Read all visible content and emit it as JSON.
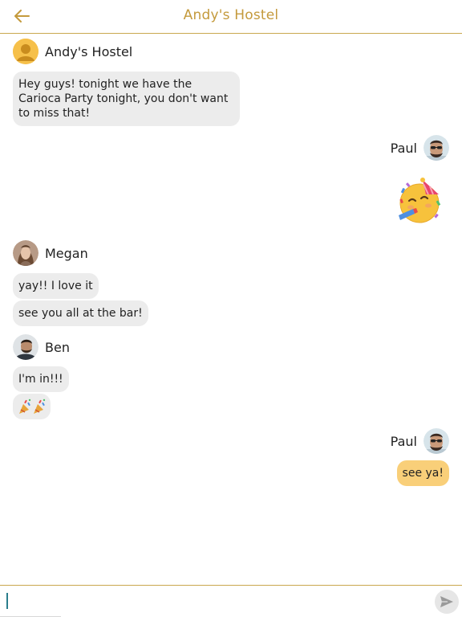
{
  "header": {
    "title": "Andy's Hostel",
    "back_icon": "arrow-left-icon",
    "accent_color": "#c49a3c"
  },
  "messages": [
    {
      "sender": "Andy's Hostel",
      "avatar": "default-user-avatar",
      "bubbles": [
        "Hey guys! tonight we have the Carioca Party tonight, you don't want to miss that!"
      ]
    },
    {
      "sender": "Paul",
      "avatar": "paul-photo-avatar",
      "bubbles": [
        "partying-face-emoji"
      ]
    },
    {
      "sender": "Megan",
      "avatar": "megan-photo-avatar",
      "bubbles": [
        "yay!! I love it",
        "see you all at the bar!"
      ]
    },
    {
      "sender": "Ben",
      "avatar": "ben-photo-avatar",
      "bubbles": [
        "I'm in!!!",
        "party-popper-emoji x2"
      ]
    },
    {
      "sender": "Paul",
      "avatar": "paul-photo-avatar",
      "bubbles": [
        "see ya!"
      ]
    }
  ],
  "composer": {
    "value": "",
    "send_icon": "send-icon"
  },
  "colors": {
    "own_bubble": "#f9cf79",
    "other_bubble": "#ececec",
    "divider": "#c9a84f"
  }
}
